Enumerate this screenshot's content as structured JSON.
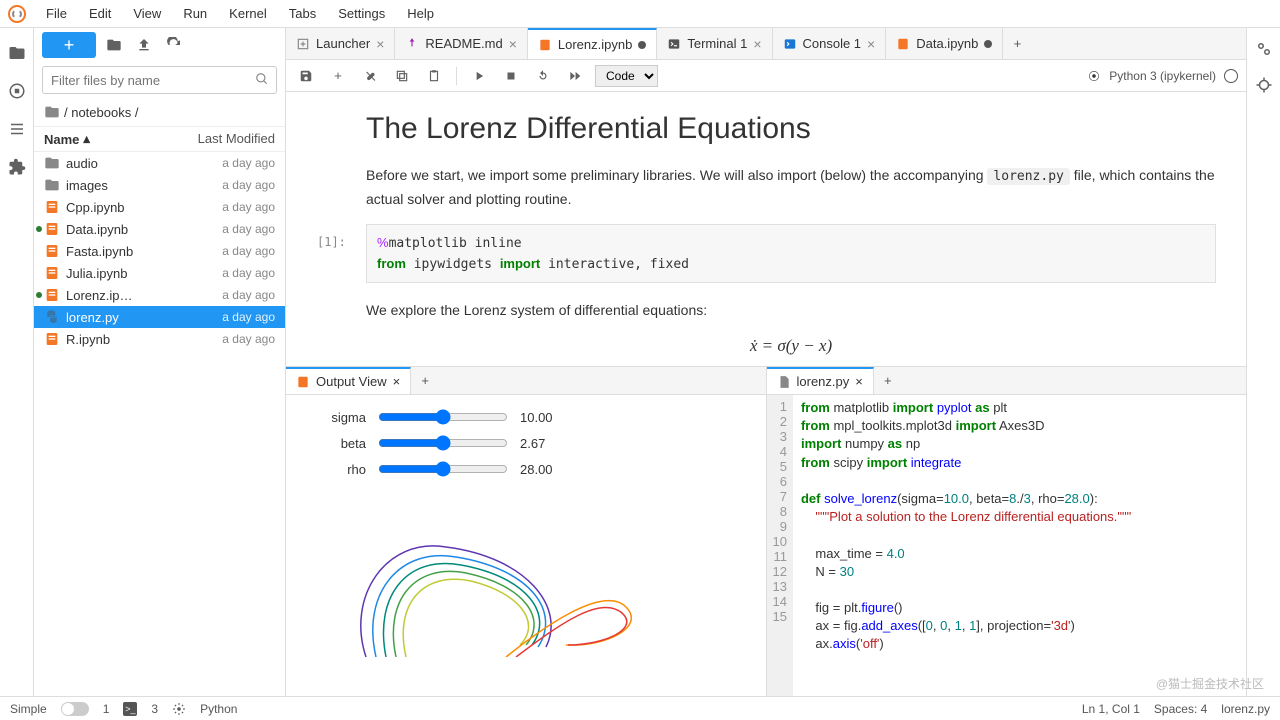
{
  "menubar": [
    "File",
    "Edit",
    "View",
    "Run",
    "Kernel",
    "Tabs",
    "Settings",
    "Help"
  ],
  "sidebar": {
    "filter_placeholder": "Filter files by name",
    "breadcrumb": " / notebooks /",
    "columns": {
      "name": "Name",
      "modified": "Last Modified"
    },
    "files": [
      {
        "name": "audio",
        "kind": "folder",
        "mod": "a day ago",
        "running": false
      },
      {
        "name": "images",
        "kind": "folder",
        "mod": "a day ago",
        "running": false
      },
      {
        "name": "Cpp.ipynb",
        "kind": "nb",
        "mod": "a day ago",
        "running": false
      },
      {
        "name": "Data.ipynb",
        "kind": "nb",
        "mod": "a day ago",
        "running": true
      },
      {
        "name": "Fasta.ipynb",
        "kind": "nb",
        "mod": "a day ago",
        "running": false
      },
      {
        "name": "Julia.ipynb",
        "kind": "nb",
        "mod": "a day ago",
        "running": false
      },
      {
        "name": "Lorenz.ip…",
        "kind": "nb",
        "mod": "a day ago",
        "running": true
      },
      {
        "name": "lorenz.py",
        "kind": "py",
        "mod": "a day ago",
        "running": false,
        "selected": true
      },
      {
        "name": "R.ipynb",
        "kind": "nb",
        "mod": "a day ago",
        "running": false
      }
    ]
  },
  "tabs": [
    {
      "label": "Launcher",
      "kind": "launcher",
      "dirty": false
    },
    {
      "label": "README.md",
      "kind": "md",
      "dirty": false
    },
    {
      "label": "Lorenz.ipynb",
      "kind": "nb",
      "dirty": true,
      "active": true
    },
    {
      "label": "Terminal 1",
      "kind": "term",
      "dirty": false
    },
    {
      "label": "Console 1",
      "kind": "cons",
      "dirty": false
    },
    {
      "label": "Data.ipynb",
      "kind": "nb",
      "dirty": true
    }
  ],
  "nb_toolbar": {
    "cell_type": "Code",
    "kernel": "Python 3 (ipykernel)"
  },
  "notebook": {
    "title": "The Lorenz Differential Equations",
    "intro_a": "Before we start, we import some preliminary libraries. We will also import (below) the accompanying ",
    "intro_code": "lorenz.py",
    "intro_b": " file, which contains the actual solver and plotting routine.",
    "prompt": "[1]:",
    "src": "%matplotlib inline\nfrom ipywidgets import interactive, fixed",
    "para2": "We explore the Lorenz system of differential equations:",
    "eq": "ẋ = σ(y − x)"
  },
  "output_panel": {
    "title": "Output View",
    "sliders": [
      {
        "label": "sigma",
        "value": "10.00"
      },
      {
        "label": "beta",
        "value": "2.67"
      },
      {
        "label": "rho",
        "value": "28.00"
      }
    ]
  },
  "editor_panel": {
    "title": "lorenz.py",
    "lines": [
      "from matplotlib import pyplot as plt",
      "from mpl_toolkits.mplot3d import Axes3D",
      "import numpy as np",
      "from scipy import integrate",
      "",
      "def solve_lorenz(sigma=10.0, beta=8./3, rho=28.0):",
      "    \"\"\"Plot a solution to the Lorenz differential equations.\"\"\"",
      "",
      "    max_time = 4.0",
      "    N = 30",
      "",
      "    fig = plt.figure()",
      "    ax = fig.add_axes([0, 0, 1, 1], projection='3d')",
      "    ax.axis('off')",
      ""
    ]
  },
  "status": {
    "simple": "Simple",
    "w": "1",
    "t": "3",
    "lang": "Python",
    "cursor": "Ln 1, Col 1",
    "spaces": "Spaces: 4",
    "file": "lorenz.py"
  },
  "watermark": "@猫士掘金技术社区"
}
